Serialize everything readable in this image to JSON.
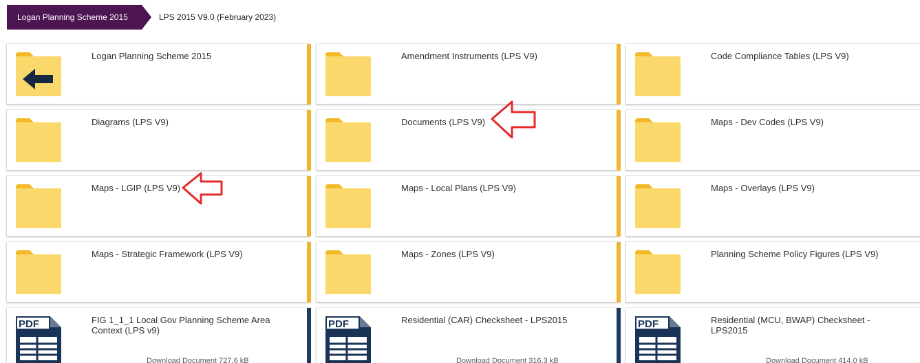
{
  "breadcrumb": {
    "root": "Logan Planning Scheme 2015",
    "current": "LPS 2015 V9.0 (February 2023)"
  },
  "colors": {
    "brand": "#4d1552",
    "folder_accent": "#f0b42f",
    "document_accent": "#1e3a5f",
    "folder_body": "#fad86b",
    "folder_tab": "#f4b928",
    "annotation": "#e32b2b"
  },
  "tiles": [
    {
      "kind": "folder-back",
      "title": "Logan Planning Scheme 2015"
    },
    {
      "kind": "folder",
      "title": "Amendment Instruments (LPS V9)"
    },
    {
      "kind": "folder",
      "title": "Code Compliance Tables (LPS V9)"
    },
    {
      "kind": "folder",
      "title": "Diagrams (LPS V9)"
    },
    {
      "kind": "folder",
      "title": "Documents (LPS V9)"
    },
    {
      "kind": "folder",
      "title": "Maps - Dev Codes (LPS V9)"
    },
    {
      "kind": "folder",
      "title": "Maps - LGIP (LPS V9)"
    },
    {
      "kind": "folder",
      "title": "Maps - Local Plans (LPS V9)"
    },
    {
      "kind": "folder",
      "title": "Maps - Overlays (LPS V9)"
    },
    {
      "kind": "folder",
      "title": "Maps - Strategic Framework (LPS V9)"
    },
    {
      "kind": "folder",
      "title": "Maps - Zones (LPS V9)"
    },
    {
      "kind": "folder",
      "title": "Planning Scheme Policy Figures (LPS V9)"
    },
    {
      "kind": "pdf",
      "title": "FIG 1_1_1 Local Gov Planning Scheme Area Context (LPS v9)",
      "meta": "Download Document 727.6 kB"
    },
    {
      "kind": "pdf",
      "title": "Residential (CAR) Checksheet - LPS2015",
      "meta": "Download Document 316.3 kB"
    },
    {
      "kind": "pdf",
      "title": "Residential (MCU, BWAP) Checksheet - LPS2015",
      "meta": "Download Document 414.0 kB"
    }
  ],
  "icons": {
    "folder": "folder-icon",
    "back": "back-arrow-icon",
    "pdf": "pdf-document-icon",
    "annotation": "red-pointer-arrow-icon"
  }
}
